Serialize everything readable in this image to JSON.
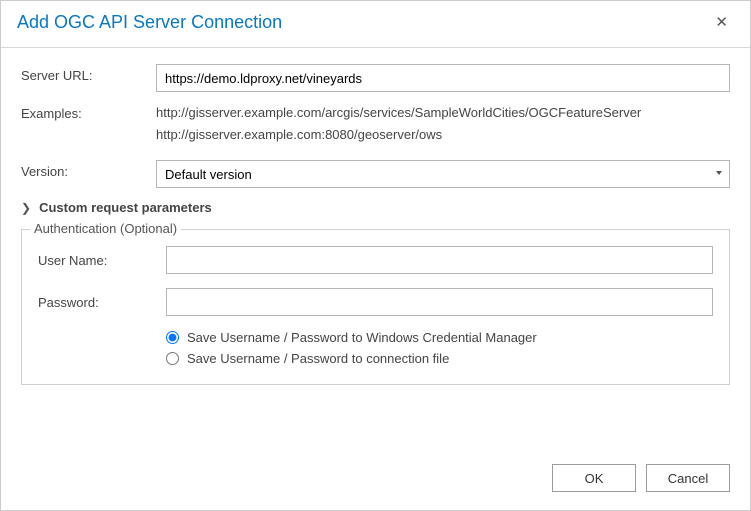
{
  "dialog": {
    "title": "Add OGC API Server Connection"
  },
  "form": {
    "server_url_label": "Server URL:",
    "server_url_value": "https://demo.ldproxy.net/vineyards",
    "examples_label": "Examples:",
    "example1": "http://gisserver.example.com/arcgis/services/SampleWorldCities/OGCFeatureServer",
    "example2": "http://gisserver.example.com:8080/geoserver/ows",
    "version_label": "Version:",
    "version_value": "Default version"
  },
  "expander": {
    "label": "Custom request parameters"
  },
  "auth": {
    "legend": "Authentication (Optional)",
    "username_label": "User Name:",
    "username_value": "",
    "password_label": "Password:",
    "password_value": "",
    "radio1": "Save Username / Password to Windows Credential Manager",
    "radio2": "Save Username / Password to connection file"
  },
  "buttons": {
    "ok": "OK",
    "cancel": "Cancel"
  }
}
